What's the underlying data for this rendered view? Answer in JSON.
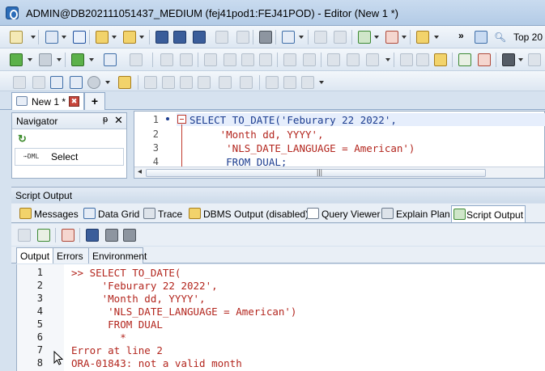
{
  "window": {
    "title": "ADMIN@DB202111051437_MEDIUM (fej41pod1:FEJ41POD) - Editor (New 1 *)"
  },
  "toolbar1": {
    "top_label": "Top 20"
  },
  "tabs": {
    "document_tab": "New 1 *",
    "close_symbol": "✖",
    "new_tab": "+"
  },
  "navigator": {
    "title": "Navigator",
    "pin_symbol": "ᵽ",
    "close_symbol": "✕",
    "refresh_symbol": "↻",
    "dml_prefix": "⋯DML",
    "item": "Select"
  },
  "editor": {
    "lines": [
      {
        "num": "1",
        "text": "SELECT TO_DATE('Feburary 22 2022',"
      },
      {
        "num": "2",
        "text": "     'Month dd, YYYY',"
      },
      {
        "num": "3",
        "text": "      'NLS_DATE_LANGUAGE = American')"
      },
      {
        "num": "4",
        "text": "      FROM DUAL;"
      }
    ],
    "scroll_left": "◂",
    "scroll_grip": "|||"
  },
  "script_output": {
    "title": "Script Output",
    "tabs": [
      {
        "label": "Messages"
      },
      {
        "label": "Data Grid"
      },
      {
        "label": "Trace"
      },
      {
        "label": "DBMS Output (disabled)"
      },
      {
        "label": "Query Viewer"
      },
      {
        "label": "Explain Plan"
      },
      {
        "label": "Script Output"
      }
    ],
    "inner_tabs": [
      "Output",
      "Errors",
      "Environment"
    ],
    "lines": [
      {
        "num": "1",
        "text": ">> SELECT TO_DATE("
      },
      {
        "num": "2",
        "text": "     'Feburary 22 2022',"
      },
      {
        "num": "3",
        "text": "     'Month dd, YYYY',"
      },
      {
        "num": "4",
        "text": "      'NLS_DATE_LANGUAGE = American')"
      },
      {
        "num": "5",
        "text": "      FROM DUAL"
      },
      {
        "num": "6",
        "text": "        *"
      },
      {
        "num": "7",
        "text": "Error at line 2"
      },
      {
        "num": "8",
        "text": "ORA-01843: not a valid month"
      }
    ]
  },
  "colors": {
    "sql_text": "#b3261e",
    "chrome": "#d6e2ef"
  }
}
